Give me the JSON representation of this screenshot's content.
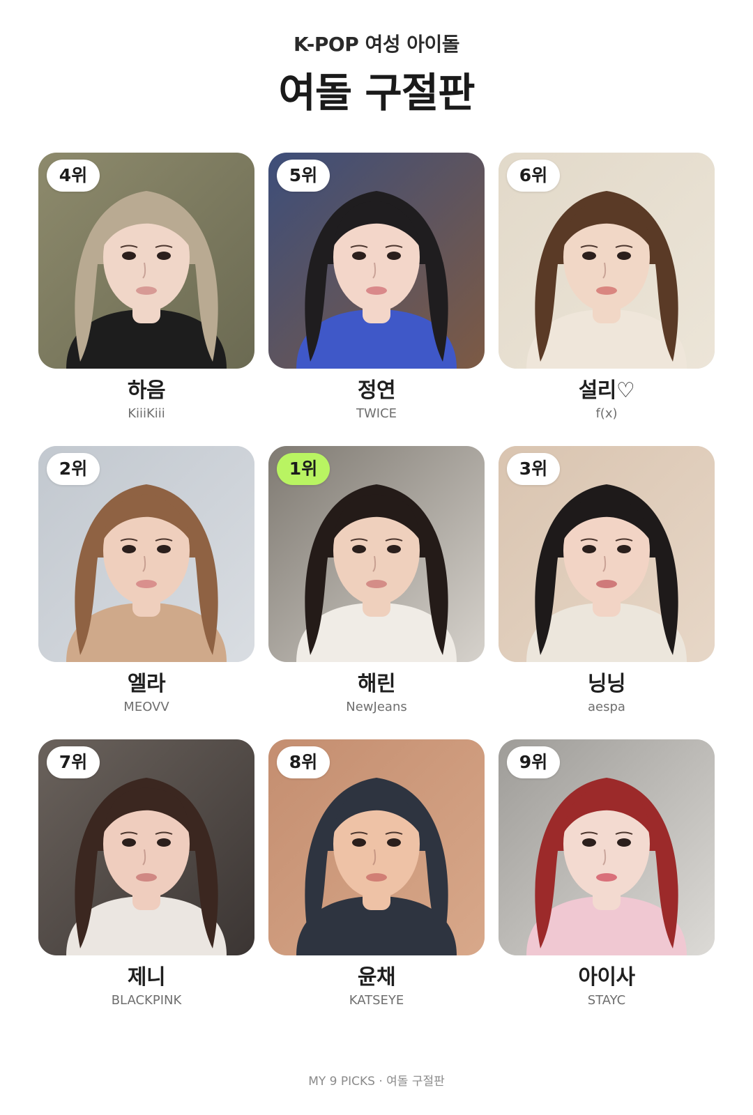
{
  "header": {
    "subtitle": "K-POP 여성 아이돌",
    "title": "여돌 구절판"
  },
  "cards": [
    {
      "rank": "4위",
      "name": "하음",
      "group": "KiiiKiii",
      "is_top": false,
      "palette": {
        "bg": "#6b6a52",
        "bg2": "#8d8a6c",
        "hair": "#b9aa92",
        "skin": "#f0d6c8",
        "top": "#1d1d1d",
        "lips": "#d79a95"
      }
    },
    {
      "rank": "5위",
      "name": "정연",
      "group": "TWICE",
      "is_top": false,
      "palette": {
        "bg": "#7d5a44",
        "bg2": "#3d4e7a",
        "hair": "#1f1d1f",
        "skin": "#f3d6c9",
        "top": "#3f58c8",
        "lips": "#d9898a"
      }
    },
    {
      "rank": "6위",
      "name": "설리♡",
      "group": "f(x)",
      "is_top": false,
      "palette": {
        "bg": "#ece5d8",
        "bg2": "#e2d9c9",
        "hair": "#5a3a26",
        "skin": "#f1d7c6",
        "top": "#efe6da",
        "lips": "#d98680"
      }
    },
    {
      "rank": "2위",
      "name": "엘라",
      "group": "MEOVV",
      "is_top": false,
      "palette": {
        "bg": "#d9dde2",
        "bg2": "#c2c8cf",
        "hair": "#8f6243",
        "skin": "#efcfbd",
        "top": "#cfa98a",
        "lips": "#d9908d"
      }
    },
    {
      "rank": "1위",
      "name": "해린",
      "group": "NewJeans",
      "is_top": true,
      "palette": {
        "bg": "#d6d2cc",
        "bg2": "#7f7a72",
        "hair": "#241b18",
        "skin": "#efd0bd",
        "top": "#f0ece6",
        "lips": "#d48d87"
      }
    },
    {
      "rank": "3위",
      "name": "닝닝",
      "group": "aespa",
      "is_top": false,
      "palette": {
        "bg": "#e7d7c7",
        "bg2": "#d9c4b0",
        "hair": "#1e1a1a",
        "skin": "#f2d4c5",
        "top": "#ece6dc",
        "lips": "#cf7a7a"
      }
    },
    {
      "rank": "7위",
      "name": "제니",
      "group": "BLACKPINK",
      "is_top": false,
      "palette": {
        "bg": "#3b3533",
        "bg2": "#6a625c",
        "hair": "#3b2720",
        "skin": "#efcdbe",
        "top": "#ebe6e1",
        "lips": "#d08883"
      }
    },
    {
      "rank": "8위",
      "name": "윤채",
      "group": "KATSEYE",
      "is_top": false,
      "palette": {
        "bg": "#d8a88a",
        "bg2": "#c48e70",
        "hair": "#2e3440",
        "skin": "#eec2a6",
        "top": "#2e3440",
        "lips": "#d17f75"
      }
    },
    {
      "rank": "9위",
      "name": "아이사",
      "group": "STAYC",
      "is_top": false,
      "palette": {
        "bg": "#dcdad6",
        "bg2": "#9e9c98",
        "hair": "#9c2a2a",
        "skin": "#f3dad0",
        "top": "#f0c8d2",
        "lips": "#d9707a"
      }
    }
  ],
  "footer": {
    "text": "MY 9 PICKS · 여돌 구절판"
  },
  "colors": {
    "top_badge": "#b9f462",
    "badge": "#ffffff",
    "group_text": "#6e6e6e"
  }
}
